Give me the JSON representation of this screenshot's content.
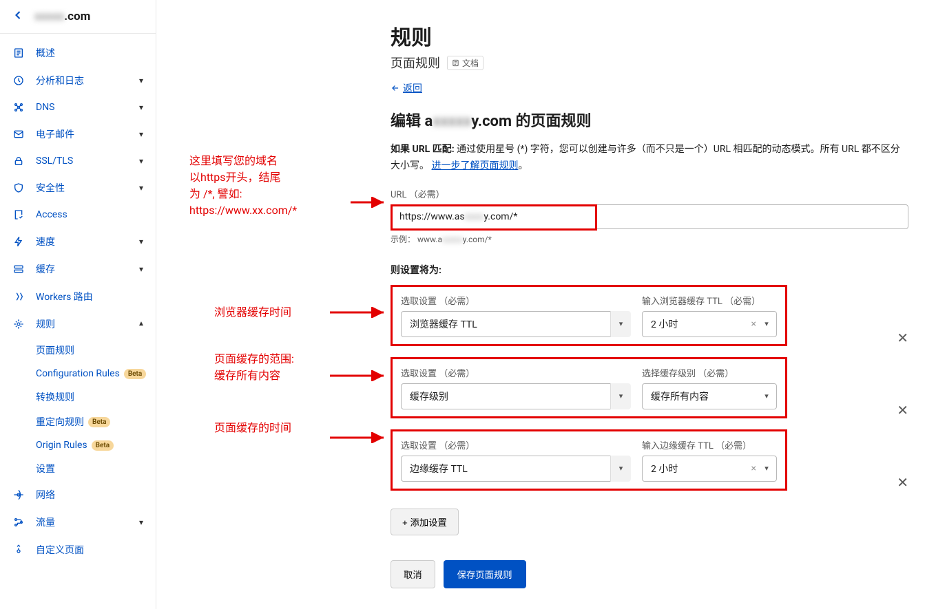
{
  "header": {
    "domain_suffix": ".com",
    "domain_blur": "xxxxx"
  },
  "sidebar": {
    "items": [
      {
        "icon": "overview",
        "label": "概述",
        "expand": false
      },
      {
        "icon": "analytics",
        "label": "分析和日志",
        "expand": true
      },
      {
        "icon": "dns",
        "label": "DNS",
        "expand": true
      },
      {
        "icon": "email",
        "label": "电子邮件",
        "expand": true
      },
      {
        "icon": "lock",
        "label": "SSL/TLS",
        "expand": true
      },
      {
        "icon": "shield",
        "label": "安全性",
        "expand": true
      },
      {
        "icon": "access",
        "label": "Access",
        "expand": false
      },
      {
        "icon": "bolt",
        "label": "速度",
        "expand": true
      },
      {
        "icon": "cache",
        "label": "缓存",
        "expand": true
      },
      {
        "icon": "workers",
        "label": "Workers 路由",
        "expand": false
      },
      {
        "icon": "rules",
        "label": "规则",
        "expand": true,
        "expanded": true
      },
      {
        "icon": "network",
        "label": "网络",
        "expand": false
      },
      {
        "icon": "traffic",
        "label": "流量",
        "expand": true
      },
      {
        "icon": "custom",
        "label": "自定义页面",
        "expand": false
      }
    ],
    "rules_sub": [
      {
        "label": "页面规则",
        "badge": null
      },
      {
        "label": "Configuration Rules",
        "badge": "Beta"
      },
      {
        "label": "转换规则",
        "badge": null
      },
      {
        "label": "重定向规则",
        "badge": "Beta"
      },
      {
        "label": "Origin Rules",
        "badge": "Beta"
      },
      {
        "label": "设置",
        "badge": null
      }
    ]
  },
  "main": {
    "title": "规则",
    "subtitle": "页面规则",
    "doc_badge": "文档",
    "back": "返回",
    "edit_heading_prefix": "编辑 a",
    "edit_heading_blur": "xxxxx",
    "edit_heading_suffix": "y.com 的页面规则",
    "match_label": "如果 URL 匹配:",
    "match_text": "通过使用星号 (*) 字符，您可以创建与许多（而不只是一个）URL 相匹配的动态模式。所有 URL 都不区分大小写。",
    "match_link": "进一步了解页面规则",
    "url_label": "URL （必需）",
    "url_value_prefix": "https://www.as",
    "url_value_suffix": "y.com/*",
    "url_value_blur": "xxxx",
    "example_prefix": "示例：  www.a",
    "example_blur": "xxxxx",
    "example_suffix": "y.com/*",
    "then_title": "则设置将为:",
    "settings": [
      {
        "pick_label": "选取设置 （必需）",
        "pick_value": "浏览器缓存 TTL",
        "val_label": "输入浏览器缓存 TTL （必需）",
        "val_value": "2 小时",
        "has_clear": true
      },
      {
        "pick_label": "选取设置 （必需）",
        "pick_value": "缓存级别",
        "val_label": "选择缓存级别 （必需）",
        "val_value": "缓存所有内容",
        "has_clear": false
      },
      {
        "pick_label": "选取设置 （必需）",
        "pick_value": "边缘缓存 TTL",
        "val_label": "输入边缘缓存 TTL （必需）",
        "val_value": "2 小时",
        "has_clear": true
      }
    ],
    "add_btn": "+ 添加设置",
    "cancel": "取消",
    "save": "保存页面规则"
  },
  "annotations": {
    "url_note": "这里填写您的域名\n以https开头，结尾\n为 /*, 譬如:\nhttps://www.xx.com/*",
    "s1": "浏览器缓存时间",
    "s2": "页面缓存的范围:\n缓存所有内容",
    "s3": "页面缓存的时间"
  }
}
